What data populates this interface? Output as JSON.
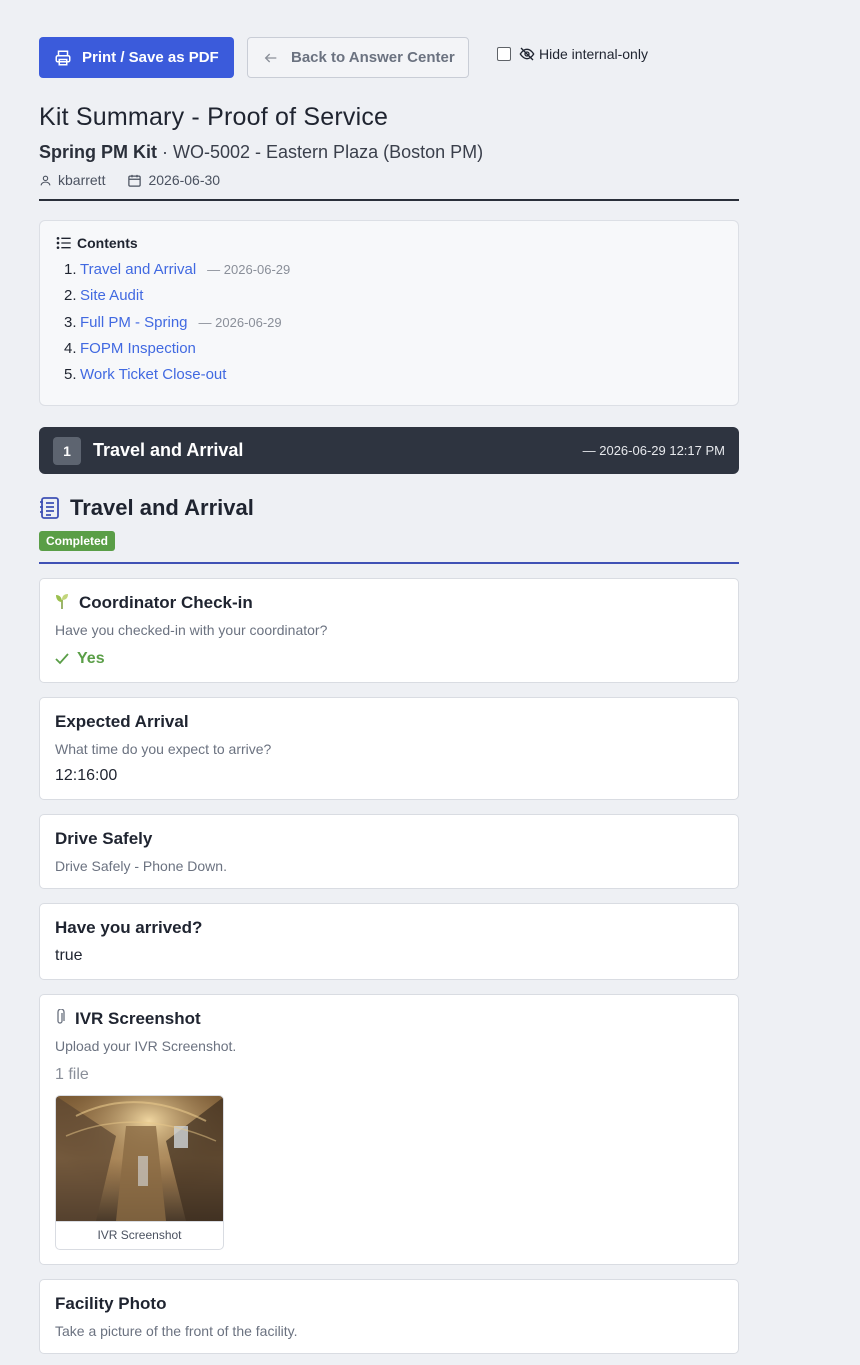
{
  "toolbar": {
    "print_label": "Print / Save as PDF",
    "back_label": "Back to Answer Center",
    "hide_internal_label": "Hide internal-only"
  },
  "header": {
    "title": "Kit Summary - Proof of Service",
    "kit_name": "Spring PM Kit",
    "separator": " · ",
    "work_order": "WO-5002 - Eastern Plaza (Boston PM)",
    "user": "kbarrett",
    "date": "2026-06-30"
  },
  "toc": {
    "heading": "Contents",
    "items": [
      {
        "num": "1.",
        "label": "Travel and Arrival",
        "date": "— 2026-06-29"
      },
      {
        "num": "2.",
        "label": "Site Audit",
        "date": ""
      },
      {
        "num": "3.",
        "label": "Full PM - Spring",
        "date": "— 2026-06-29"
      },
      {
        "num": "4.",
        "label": "FOPM Inspection",
        "date": ""
      },
      {
        "num": "5.",
        "label": "Work Ticket Close-out",
        "date": ""
      }
    ]
  },
  "section": {
    "number": "1",
    "title": "Travel and Arrival",
    "datetime": "— 2026-06-29 12:17 PM"
  },
  "form": {
    "title": "Travel and Arrival",
    "status": "Completed",
    "status_color": "#5a9e47",
    "accent": "#3f51b5"
  },
  "questions": {
    "checkin": {
      "icon": "sprout-icon",
      "title": "Coordinator Check-in",
      "desc": "Have you checked-in with your coordinator?",
      "answer": "Yes"
    },
    "arrival": {
      "title": "Expected Arrival",
      "desc": "What time do you expect to arrive?",
      "answer": "12:16:00"
    },
    "drive": {
      "title": "Drive Safely",
      "desc": "Drive Safely - Phone Down."
    },
    "arrived": {
      "title": "Have you arrived?",
      "answer": "true"
    },
    "ivr": {
      "icon": "paperclip-icon",
      "title": "IVR Screenshot",
      "desc": "Upload your IVR Screenshot.",
      "file_count": "1 file",
      "file_caption": "IVR Screenshot"
    },
    "facility": {
      "title": "Facility Photo",
      "desc": "Take a picture of the front of the facility."
    }
  }
}
